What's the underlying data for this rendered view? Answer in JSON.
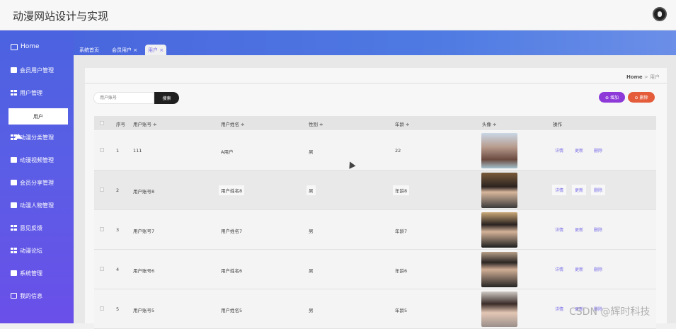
{
  "header": {
    "title": "动漫网站设计与实现"
  },
  "sidebar": {
    "items": [
      {
        "label": "Home"
      },
      {
        "label": "会员用户管理"
      },
      {
        "label": "用户管理"
      },
      {
        "label": "动漫分类管理"
      },
      {
        "label": "动漫视频管理"
      },
      {
        "label": "会员分享管理"
      },
      {
        "label": "动漫人物管理"
      },
      {
        "label": "意见反馈"
      },
      {
        "label": "动漫论坛"
      },
      {
        "label": "系统管理"
      },
      {
        "label": "我的信息"
      }
    ],
    "sub_item": "用户"
  },
  "tabs": [
    {
      "label": "系统首页"
    },
    {
      "label": "会员用户 ×"
    },
    {
      "label": "用户 ×"
    }
  ],
  "breadcrumb": {
    "home": "Home",
    "separator": ">",
    "current": "用户"
  },
  "search": {
    "placeholder": "用户账号",
    "button": "搜索"
  },
  "toolbar": {
    "add_label": "⊕ 增加",
    "delete_label": "⊖ 删除"
  },
  "table": {
    "columns": [
      "序号",
      "用户账号 ≑",
      "用户姓名 ≑",
      "性别 ≑",
      "年龄 ≑",
      "头像 ≑",
      "操作"
    ],
    "rows": [
      {
        "index": "1",
        "account": "111",
        "name": "A用户",
        "gender": "男",
        "age": "22"
      },
      {
        "index": "2",
        "account": "用户账号8",
        "name": "用户姓名8",
        "gender": "男",
        "age": "年龄8"
      },
      {
        "index": "3",
        "account": "用户账号7",
        "name": "用户姓名7",
        "gender": "男",
        "age": "年龄7"
      },
      {
        "index": "4",
        "account": "用户账号6",
        "name": "用户姓名6",
        "gender": "男",
        "age": "年龄6"
      },
      {
        "index": "5",
        "account": "用户账号5",
        "name": "用户姓名5",
        "gender": "男",
        "age": "年龄5"
      }
    ],
    "actions": {
      "detail": "详情",
      "update": "更新",
      "delete": "删除"
    }
  },
  "watermark": "CSDN @辉时科技"
}
